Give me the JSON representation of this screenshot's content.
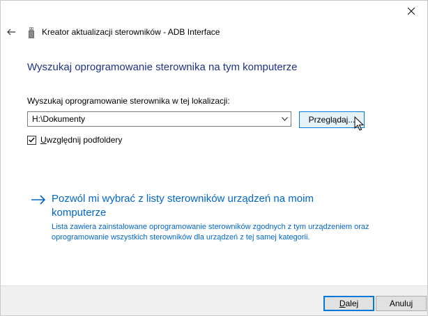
{
  "window": {
    "title": "Kreator aktualizacji sterowników - ADB Interface",
    "close_icon": "close-icon",
    "back_icon": "back-arrow-icon",
    "device_icon": "usb-device-icon"
  },
  "page": {
    "heading": "Wyszukaj oprogramowanie sterownika na tym komputerze",
    "location_label": "Wyszukaj oprogramowanie sterownika w tej lokalizacji:",
    "path_value": "H:\\Dokumenty",
    "browse_label": "Przeglądaj...",
    "include_subfolders": {
      "label_underlined": "U",
      "label_rest": "względnij podfoldery",
      "checked": true
    },
    "choose_link": "Pozwól mi wybrać z listy sterowników urządzeń na moim komputerze",
    "choose_description": "Lista zawiera zainstalowane oprogramowanie sterowników zgodnych z tym urządzeniem oraz oprogramowanie wszystkich sterowników dla urządzeń z tej samej kategorii."
  },
  "footer": {
    "next_underlined": "D",
    "next_rest": "alej",
    "cancel_label": "Anuluj"
  },
  "colors": {
    "heading": "#1e3287",
    "link": "#0066cc",
    "focus": "#0078d7"
  }
}
